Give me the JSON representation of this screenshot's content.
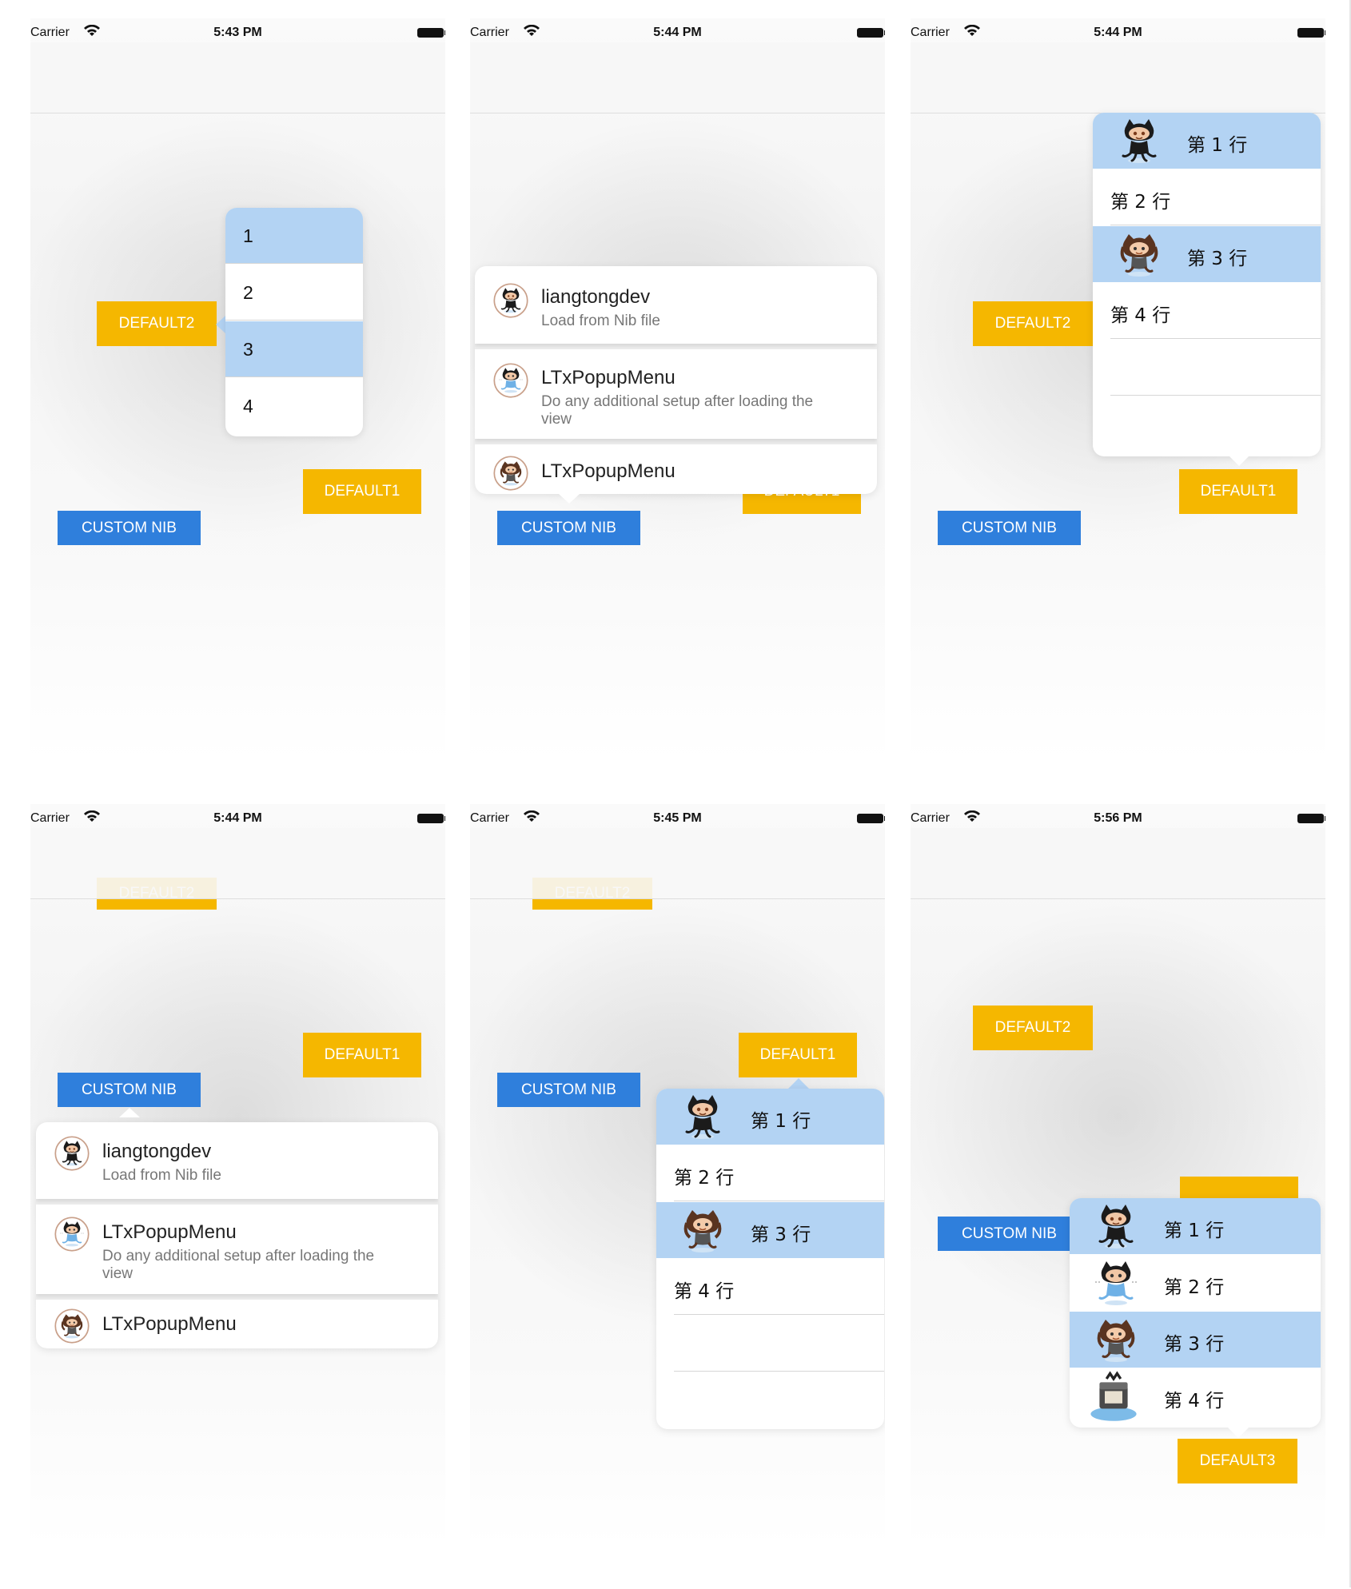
{
  "screens": [
    {
      "status": {
        "carrier": "Carrier",
        "time": "5:43 PM"
      },
      "buttons": {
        "default2": "DEFAULT2",
        "default1": "DEFAULT1",
        "custom_nib": "CUSTOM NIB"
      },
      "menu": {
        "items": [
          "1",
          "2",
          "3",
          "4"
        ]
      }
    },
    {
      "status": {
        "carrier": "Carrier",
        "time": "5:44 PM"
      },
      "buttons": {
        "default1": "DEFAULT1",
        "custom_nib": "CUSTOM NIB"
      },
      "nib_menu": {
        "items": [
          {
            "title": "liangtongdev",
            "subtitle": "Load from Nib file"
          },
          {
            "title": "LTxPopupMenu",
            "subtitle": "Do any additional setup after loading the view"
          },
          {
            "title": "LTxPopupMenu"
          }
        ]
      }
    },
    {
      "status": {
        "carrier": "Carrier",
        "time": "5:44 PM"
      },
      "buttons": {
        "default2": "DEFAULT2",
        "default1": "DEFAULT1",
        "custom_nib": "CUSTOM NIB"
      },
      "menu": {
        "items": [
          "第 1 行",
          "第 2 行",
          "第 3 行",
          "第 4 行"
        ]
      }
    },
    {
      "status": {
        "carrier": "Carrier",
        "time": "5:44 PM"
      },
      "buttons": {
        "default2": "DEFAULT2",
        "default1": "DEFAULT1",
        "custom_nib": "CUSTOM NIB"
      },
      "nib_menu": {
        "items": [
          {
            "title": "liangtongdev",
            "subtitle": "Load from Nib file"
          },
          {
            "title": "LTxPopupMenu",
            "subtitle": "Do any additional setup after loading the view"
          },
          {
            "title": "LTxPopupMenu"
          }
        ]
      }
    },
    {
      "status": {
        "carrier": "Carrier",
        "time": "5:45 PM"
      },
      "buttons": {
        "default2": "DEFAULT2",
        "default1": "DEFAULT1",
        "custom_nib": "CUSTOM NIB"
      },
      "menu": {
        "items": [
          "第 1 行",
          "第 2 行",
          "第 3 行",
          "第 4 行"
        ]
      }
    },
    {
      "status": {
        "carrier": "Carrier",
        "time": "5:56 PM"
      },
      "buttons": {
        "default2": "DEFAULT2",
        "custom_nib": "CUSTOM NIB",
        "default3": "DEFAULT3"
      },
      "menu": {
        "items": [
          "第 1 行",
          "第 2 行",
          "第 3 行",
          "第 4 行"
        ]
      }
    }
  ],
  "colors": {
    "button_yellow": "#f5b700",
    "button_blue": "#2f7fdc",
    "menu_highlight": "#b3d3f3",
    "menu_background": "#ffffff"
  },
  "icons": [
    "wifi-icon",
    "battery-icon",
    "octocat-avatar-icon",
    "octocat-girl-avatar-icon",
    "octocat-boy-avatar-icon",
    "octocat-box-avatar-icon"
  ]
}
